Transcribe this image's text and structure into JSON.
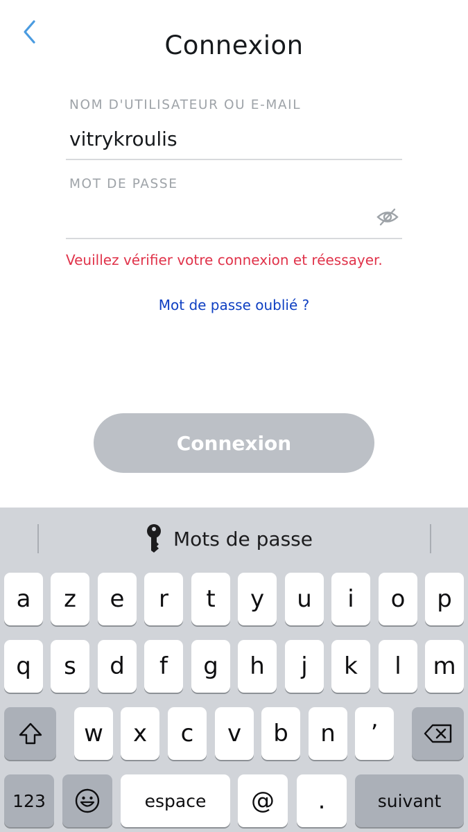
{
  "header": {
    "title": "Connexion",
    "back_icon": "chevron-left-icon"
  },
  "colors": {
    "accent_blue": "#4a9be0",
    "error_red": "#e0334a",
    "link_blue": "#0e3fc2",
    "button_disabled": "#bcc0c6",
    "keyboard_bg": "#d1d4d9"
  },
  "form": {
    "username_label": "NOM D'UTILISATEUR OU E-MAIL",
    "username_value": "vitrykroulis",
    "password_label": "MOT DE PASSE",
    "password_value": "",
    "password_toggle_icon": "eye-slash-icon",
    "error_message": "Veuillez vérifier votre connexion et réessayer.",
    "forgot_password": "Mot de passe oublié ?",
    "submit_label": "Connexion"
  },
  "keyboard": {
    "suggestion": {
      "icon": "key-icon",
      "label": "Mots de passe"
    },
    "row1": [
      "a",
      "z",
      "e",
      "r",
      "t",
      "y",
      "u",
      "i",
      "o",
      "p"
    ],
    "row2": [
      "q",
      "s",
      "d",
      "f",
      "g",
      "h",
      "j",
      "k",
      "l",
      "m"
    ],
    "row3": [
      "w",
      "x",
      "c",
      "v",
      "b",
      "n",
      "’"
    ],
    "shift_icon": "shift-icon",
    "delete_icon": "backspace-icon",
    "numbers_label": "123",
    "emoji_icon": "emoji-icon",
    "space_label": "espace",
    "at_label": "@",
    "period_label": ".",
    "return_label": "suivant"
  }
}
